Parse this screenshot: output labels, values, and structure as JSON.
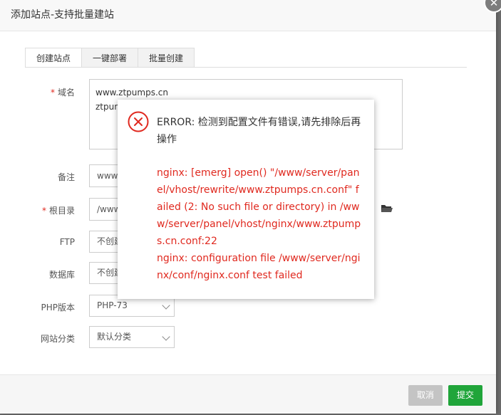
{
  "dialog": {
    "title": "添加站点-支持批量建站",
    "close_icon": "close-icon"
  },
  "tabs": [
    {
      "label": "创建站点",
      "active": true
    },
    {
      "label": "一键部署",
      "active": false
    },
    {
      "label": "批量创建",
      "active": false
    }
  ],
  "form": {
    "domain": {
      "label": "域名",
      "required": true,
      "lines": [
        "www.ztpumps.cn",
        "ztpun"
      ]
    },
    "note": {
      "label": "备注",
      "value": "www."
    },
    "root": {
      "label": "根目录",
      "required": true,
      "value": "/www",
      "icon": "folder-icon"
    },
    "ftp": {
      "label": "FTP",
      "value": "不创建"
    },
    "database": {
      "label": "数据库",
      "value": "不创建"
    },
    "php": {
      "label": "PHP版本",
      "value": "PHP-73"
    },
    "category": {
      "label": "网站分类",
      "value": "默认分类"
    }
  },
  "footer": {
    "cancel": "取消",
    "submit": "提交"
  },
  "error": {
    "icon": "error-circle-icon",
    "title": "ERROR: 检测到配置文件有错误,请先排除后再操作",
    "line1": "nginx: [emerg] open() \"/www/server/panel/vhost/rewrite/www.ztpumps.cn.conf\" failed (2: No such file or directory) in /www/server/panel/vhost/nginx/www.ztpumps.cn.conf:22",
    "line2": "nginx: configuration file /www/server/nginx/conf/nginx.conf test failed"
  },
  "colors": {
    "accent_green": "#20a53a",
    "error_red": "#e0291f",
    "cancel_gray": "#c4c4c4"
  }
}
